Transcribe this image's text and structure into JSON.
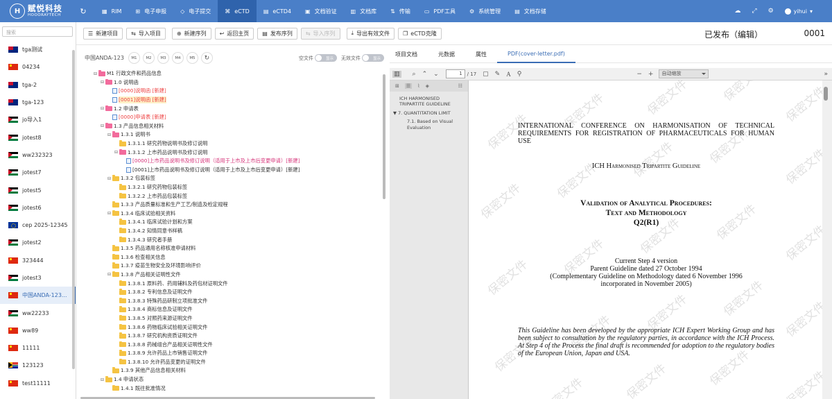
{
  "app": {
    "logo_cn": "赋悦科技",
    "logo_en": "HOOORAYTECH",
    "logo_mark": "H",
    "accent_color": "#4a7fc8",
    "active_nav_color": "#2f63ac",
    "user": "yihui"
  },
  "nav": [
    {
      "label": "RIM",
      "icon": "grid-icon"
    },
    {
      "label": "电子申报",
      "icon": "send-icon"
    },
    {
      "label": "电子提交",
      "icon": "diamond-icon"
    },
    {
      "label": "eCTD",
      "icon": "tree-icon",
      "active": true
    },
    {
      "label": "eCTD4",
      "icon": "doc-icon"
    },
    {
      "label": "文档验证",
      "icon": "check-icon"
    },
    {
      "label": "文档库",
      "icon": "library-icon"
    },
    {
      "label": "传输",
      "icon": "transfer-icon"
    },
    {
      "label": "PDF工具",
      "icon": "pdf-icon"
    },
    {
      "label": "系统管理",
      "icon": "gear-icon"
    },
    {
      "label": "文档存储",
      "icon": "storage-icon"
    }
  ],
  "sidebar": {
    "search_placeholder": "搜索",
    "projects": [
      {
        "name": "tga测试",
        "flag": "au"
      },
      {
        "name": "04234",
        "flag": "cn"
      },
      {
        "name": "tga-2",
        "flag": "au"
      },
      {
        "name": "tga-123",
        "flag": "au"
      },
      {
        "name": "jo导入1",
        "flag": "jo"
      },
      {
        "name": "jotest8",
        "flag": "jo"
      },
      {
        "name": "ww232323",
        "flag": "jo"
      },
      {
        "name": "jotest7",
        "flag": "jo"
      },
      {
        "name": "jotest5",
        "flag": "jo"
      },
      {
        "name": "jotest6",
        "flag": "jo"
      },
      {
        "name": "cep 2025-12345",
        "flag": "eu"
      },
      {
        "name": "jotest2",
        "flag": "jo"
      },
      {
        "name": "323444",
        "flag": "cn"
      },
      {
        "name": "jotest3",
        "flag": "jo"
      },
      {
        "name": "中国ANDA-123...",
        "flag": "cn",
        "active": true
      },
      {
        "name": "ww22233",
        "flag": "jo"
      },
      {
        "name": "ww89",
        "flag": "cn"
      },
      {
        "name": "11111",
        "flag": "cn"
      },
      {
        "name": "123123",
        "flag": "za"
      },
      {
        "name": "test11111",
        "flag": "cn"
      }
    ]
  },
  "toolbar": {
    "new_project": "新建项目",
    "import_project": "导入项目",
    "new_sequence": "新建序列",
    "back_home": "返回主页",
    "publish_sequence": "发布序列",
    "import_sequence": "导入序列",
    "export_valid": "导出有效文件",
    "ectd_clone": "eCTD克隆",
    "status": "已发布（编辑）",
    "sequence": "0001"
  },
  "tree_header": {
    "project": "中国ANDA-123",
    "modules": [
      "M1",
      "M2",
      "M3",
      "M4",
      "M5"
    ],
    "empty_files_label": "空文件",
    "empty_files_value": "显示",
    "invalid_files_label": "无效文件",
    "invalid_files_value": "显示"
  },
  "tree": [
    {
      "level": 0,
      "toggle": "⊟",
      "type": "folder-pink",
      "label": "M1 行政文件和药品信息"
    },
    {
      "level": 1,
      "toggle": "⊟",
      "type": "folder-pink",
      "label": "1.0 说明函"
    },
    {
      "level": 2,
      "toggle": "",
      "type": "doc",
      "label": "[0000]说明函 [新建]",
      "style": "red"
    },
    {
      "level": 2,
      "toggle": "",
      "type": "doc",
      "label": "[0001]说明函 [新建]",
      "style": "red-hl"
    },
    {
      "level": 1,
      "toggle": "⊟",
      "type": "folder-pink",
      "label": "1.2 申请表"
    },
    {
      "level": 2,
      "toggle": "",
      "type": "doc",
      "label": "[0000]申请表 [新建]",
      "style": "red"
    },
    {
      "level": 1,
      "toggle": "⊟",
      "type": "folder-pink",
      "label": "1.3 产品信息相关材料"
    },
    {
      "level": 2,
      "toggle": "⊟",
      "type": "folder-pink",
      "label": "1.3.1 说明书"
    },
    {
      "level": 3,
      "toggle": "",
      "type": "folder",
      "label": "1.3.1.1 研究药物说明书及修订说明"
    },
    {
      "level": 3,
      "toggle": "⊟",
      "type": "folder-pink",
      "label": "1.3.1.2 上市药品说明书及修订说明"
    },
    {
      "level": 4,
      "toggle": "",
      "type": "doc",
      "label": "[0000]上市药品说明书及修订说明（适用于上市及上市后变更申请）[新建]",
      "style": "pink"
    },
    {
      "level": 4,
      "toggle": "",
      "type": "doc",
      "label": "[0001]上市药品说明书及修订说明（适用于上市及上市后变更申请）[新建]",
      "style": ""
    },
    {
      "level": 2,
      "toggle": "⊟",
      "type": "folder",
      "label": "1.3.2 包装标签"
    },
    {
      "level": 3,
      "toggle": "",
      "type": "folder",
      "label": "1.3.2.1 研究药物包装标签"
    },
    {
      "level": 3,
      "toggle": "",
      "type": "folder",
      "label": "1.3.2.2 上市药品包装标签"
    },
    {
      "level": 2,
      "toggle": "",
      "type": "folder",
      "label": "1.3.3 产品质量标准和生产工艺/制造及检定规程"
    },
    {
      "level": 2,
      "toggle": "⊟",
      "type": "folder",
      "label": "1.3.4 临床试验相关资料"
    },
    {
      "level": 3,
      "toggle": "",
      "type": "folder",
      "label": "1.3.4.1 临床试验计划和方案"
    },
    {
      "level": 3,
      "toggle": "",
      "type": "folder",
      "label": "1.3.4.2 知情同意书样稿"
    },
    {
      "level": 3,
      "toggle": "",
      "type": "folder",
      "label": "1.3.4.3 研究者手册"
    },
    {
      "level": 2,
      "toggle": "",
      "type": "folder",
      "label": "1.3.5 药品通用名称核准申请材料"
    },
    {
      "level": 2,
      "toggle": "",
      "type": "folder",
      "label": "1.3.6 检查相关信息"
    },
    {
      "level": 2,
      "toggle": "",
      "type": "folder",
      "label": "1.3.7 疫苗生物安全及环境影响评价"
    },
    {
      "level": 2,
      "toggle": "⊟",
      "type": "folder",
      "label": "1.3.8 产品相关证明性文件"
    },
    {
      "level": 3,
      "toggle": "",
      "type": "folder",
      "label": "1.3.8.1 原料药、药用辅料及药包材证明文件"
    },
    {
      "level": 3,
      "toggle": "",
      "type": "folder",
      "label": "1.3.8.2 专利信息及证明文件"
    },
    {
      "level": 3,
      "toggle": "",
      "type": "folder",
      "label": "1.3.8.3 特殊药品研制立项批准文件"
    },
    {
      "level": 3,
      "toggle": "",
      "type": "folder",
      "label": "1.3.8.4 商标信息及证明文件"
    },
    {
      "level": 3,
      "toggle": "",
      "type": "folder",
      "label": "1.3.8.5 对照药来源证明文件"
    },
    {
      "level": 3,
      "toggle": "",
      "type": "folder",
      "label": "1.3.8.6 药物临床试验相关证明文件"
    },
    {
      "level": 3,
      "toggle": "",
      "type": "folder",
      "label": "1.3.8.7 研究机构资质证明文件"
    },
    {
      "level": 3,
      "toggle": "",
      "type": "folder",
      "label": "1.3.8.8 药械组合产品相关证明性文件"
    },
    {
      "level": 3,
      "toggle": "",
      "type": "folder",
      "label": "1.3.8.9 允许药品上市销售证明文件"
    },
    {
      "level": 3,
      "toggle": "",
      "type": "folder",
      "label": "1.3.8.10 允许药品变更的证明文件"
    },
    {
      "level": 2,
      "toggle": "",
      "type": "folder",
      "label": "1.3.9 其他产品信息相关材料"
    },
    {
      "level": 1,
      "toggle": "⊟",
      "type": "folder",
      "label": "1.4 申请状态"
    },
    {
      "level": 2,
      "toggle": "",
      "type": "folder",
      "label": "1.4.1 既往批准情况"
    }
  ],
  "right_tabs": [
    "项目文档",
    "元数据",
    "属性",
    "PDF(cover-letter.pdf)"
  ],
  "pdf_toolbar": {
    "page_current": "1",
    "page_total": "/ 17",
    "zoom": "自动缩放"
  },
  "outline": [
    {
      "label": "ICH HARMONISED TRIPARTITE GUIDELINE",
      "sub": false,
      "caret": ""
    },
    {
      "label": "7. QUANTITATION LIMIT",
      "sub": false,
      "caret": "▼"
    },
    {
      "label": "7.1. Based on Visual Evaluation",
      "sub": true,
      "caret": ""
    }
  ],
  "pdf_page": {
    "conference": "INTERNATIONAL CONFERENCE ON HARMONISATION OF TECHNICAL REQUIREMENTS FOR REGISTRATION OF PHARMACEUTICALS FOR HUMAN USE",
    "guideline": "ICH Harmonised Tripartite Guideline",
    "title1": "Validation of Analytical Procedures:",
    "title2": "Text and Methodology",
    "title3": "Q2(R1)",
    "version1": "Current Step 4 version",
    "version2": "Parent Guideline dated 27 October 1994",
    "version3": "(Complementary Guideline on Methodology dated 6 November 1996",
    "version4": "incorporated in November 2005)",
    "body": "This Guideline has been developed by the appropriate ICH Expert Working Group and has been subject to consultation by the regulatory parties, in accordance with the ICH Process. At Step 4 of the Process the final draft is recommended for adoption to the regulatory bodies of the European Union, Japan and USA.",
    "watermark": "保密文件"
  }
}
